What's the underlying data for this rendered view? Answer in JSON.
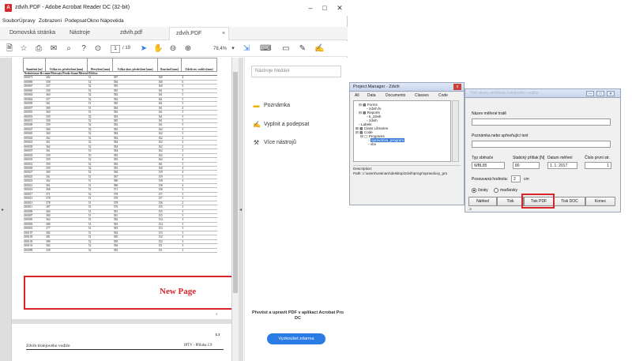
{
  "acrobat": {
    "window_title": "zdvih.PDF - Adobe Acrobat Reader DC (32-bit)",
    "menu": [
      "Soubor",
      "Úpravy",
      "Zobrazení",
      "Podepsat",
      "Okno",
      "Nápověda"
    ],
    "tabs": [
      "Domovská stránka",
      "Nástroje",
      "zdvih.pdf",
      "zdvih.PDF"
    ],
    "tab_close": "×",
    "page_current": "1",
    "page_total": "/ 19",
    "zoom": "78,4%",
    "window_buttons": [
      "–",
      "□",
      "✕"
    ],
    "document": {
      "headers": [
        "Staničení [m]",
        "Výška tes. předvýšení [mm]",
        "Převýšení [mm]",
        "Výška skut. předvýšení [mm]",
        "Rozchod [mm]",
        "Zdvih tes. vodiče [mm]"
      ],
      "subheader": "Nedořešeno-lk-cmm/Mezvaty/Prodr.Stane/Mezvul/Ukliva",
      "rows": [
        [
          "000071",
          "302",
          "51",
          "587",
          "160",
          "4"
        ],
        [
          "000069",
          "358",
          "52",
          "584",
          "160",
          "6"
        ],
        [
          "000067",
          "357",
          "52",
          "585",
          "160",
          "5"
        ],
        [
          "000065",
          "358",
          "52",
          "585",
          "161",
          "5"
        ],
        [
          "000063",
          "360",
          "52",
          "582",
          "161",
          "5"
        ],
        [
          "000062",
          "357",
          "52",
          "582",
          "161",
          "5"
        ],
        [
          "000059",
          "361",
          "51",
          "585",
          "161",
          "5"
        ],
        [
          "000057",
          "380",
          "51",
          "584",
          "161",
          "4"
        ],
        [
          "000055",
          "360",
          "51",
          "583",
          "161",
          "5"
        ],
        [
          "000053",
          "359",
          "52",
          "583",
          "161",
          "5"
        ],
        [
          "000051",
          "358",
          "52",
          "585",
          "161",
          "5"
        ],
        [
          "000049",
          "359",
          "52",
          "582",
          "161",
          "5"
        ],
        [
          "000047",
          "360",
          "52",
          "583",
          "162",
          "3"
        ],
        [
          "000045",
          "360",
          "52",
          "584",
          "162",
          "3"
        ],
        [
          "000043",
          "362",
          "52",
          "584",
          "162",
          "2"
        ],
        [
          "000041",
          "361",
          "52",
          "584",
          "162",
          "2"
        ],
        [
          "000039",
          "362",
          "52",
          "584",
          "162",
          "2"
        ],
        [
          "000037",
          "361",
          "53",
          "584",
          "162",
          "3"
        ],
        [
          "000035",
          "359",
          "53",
          "583",
          "162",
          "3"
        ],
        [
          "000033",
          "359",
          "52",
          "583",
          "162",
          "4"
        ],
        [
          "000031",
          "359",
          "52",
          "583",
          "161",
          "5"
        ],
        [
          "000029",
          "359",
          "52",
          "583",
          "160",
          "4"
        ],
        [
          "000027",
          "360",
          "52",
          "584",
          "159",
          "4"
        ],
        [
          "000025",
          "361",
          "51",
          "587",
          "159",
          "3"
        ],
        [
          "000023",
          "362",
          "51",
          "586",
          "158",
          "3"
        ],
        [
          "000021",
          "361",
          "51",
          "586",
          "158",
          "4"
        ],
        [
          "000019",
          "368",
          "51",
          "571",
          "158",
          "3"
        ],
        [
          "000017",
          "371",
          "52",
          "578",
          "157",
          "3"
        ],
        [
          "000015",
          "378",
          "51",
          "578",
          "157",
          "3"
        ],
        [
          "000013",
          "378",
          "51",
          "578",
          "156",
          "2"
        ],
        [
          "000011",
          "387",
          "51",
          "576",
          "155",
          "3"
        ],
        [
          "000009",
          "360",
          "51",
          "581",
          "155",
          "3"
        ],
        [
          "000007",
          "380",
          "51",
          "581",
          "155",
          "3"
        ],
        [
          "000005",
          "364",
          "51",
          "582",
          "154",
          "3"
        ],
        [
          "000003",
          "380",
          "51",
          "583",
          "154",
          "3"
        ],
        [
          "000001",
          "377",
          "51",
          "583",
          "153",
          "3"
        ],
        [
          "000107",
          "382",
          "51",
          "584",
          "153",
          "3"
        ],
        [
          "000105",
          "381",
          "51",
          "585",
          "152",
          "4"
        ],
        [
          "000103",
          "380",
          "52",
          "585",
          "152",
          "3"
        ],
        [
          "000101",
          "382",
          "52",
          "584",
          "151",
          "3"
        ],
        [
          "000099",
          "358",
          "52",
          "583",
          "151",
          "3"
        ]
      ],
      "new_page_label": "New Page",
      "page_number": "1",
      "footer_l3": "L3",
      "footer_left": "Zdvih trolejového vodiče",
      "footer_right": "IPTV - Příloha č.9"
    },
    "pane": {
      "search_placeholder": "Nástroje hledání",
      "items": [
        "Poznámka",
        "Vyplnit a podepsat",
        "Více nástrojů"
      ],
      "promo_text": "Převést a upravit PDF v aplikaci Acrobat Pro DC",
      "promo_button": "Vyzkoušet zdarma"
    }
  },
  "project_manager": {
    "title": "Project Manager - Zdvih",
    "close": "x",
    "tabs": [
      "All",
      "Data",
      "Documents",
      "Classes",
      "Code"
    ],
    "tree": [
      "Forms",
      "zdvih.fv",
      "Reports",
      "k_zdvih",
      "zdvih",
      "Labels",
      "Class Libraries",
      "Code",
      "Programs",
      "opravdova_program",
      "vbx"
    ],
    "description_label": "Description:",
    "path_text": "Path: c:\\users\\vvsinam\\desktop\\zdvih\\progr\\opravdovy_pro"
  },
  "dialog": {
    "title": "Tisk strany přehledu trolejového vodiče",
    "window_buttons": [
      "—",
      "□",
      "✕"
    ],
    "field_nazev_label": "Název měřené tratě",
    "field_nazev_value": "",
    "field_poznamka_label": "Poznámka nebo upřesňující text",
    "field_poznamka_value": "",
    "typ_label": "Typ sběrače",
    "typ_value": "WBL85",
    "pritlak_label": "Statický přítlak [N]",
    "pritlak_value": "80",
    "datum_label": "Datum měření",
    "datum_value": "1. 1. 2017",
    "cislo_label": "Číslo první str.",
    "cislo_value": "1",
    "posun_label": "Posouvaná hodnota:",
    "posun_value": "2",
    "posun_unit": "cm",
    "radio_cesky": "česky",
    "radio_madarsky": "maďarsky",
    "buttons": [
      "Náhled",
      "Tisk",
      "Tisk PDF",
      "Tisk DOC",
      "Konec"
    ],
    "small_mark": "-3"
  }
}
